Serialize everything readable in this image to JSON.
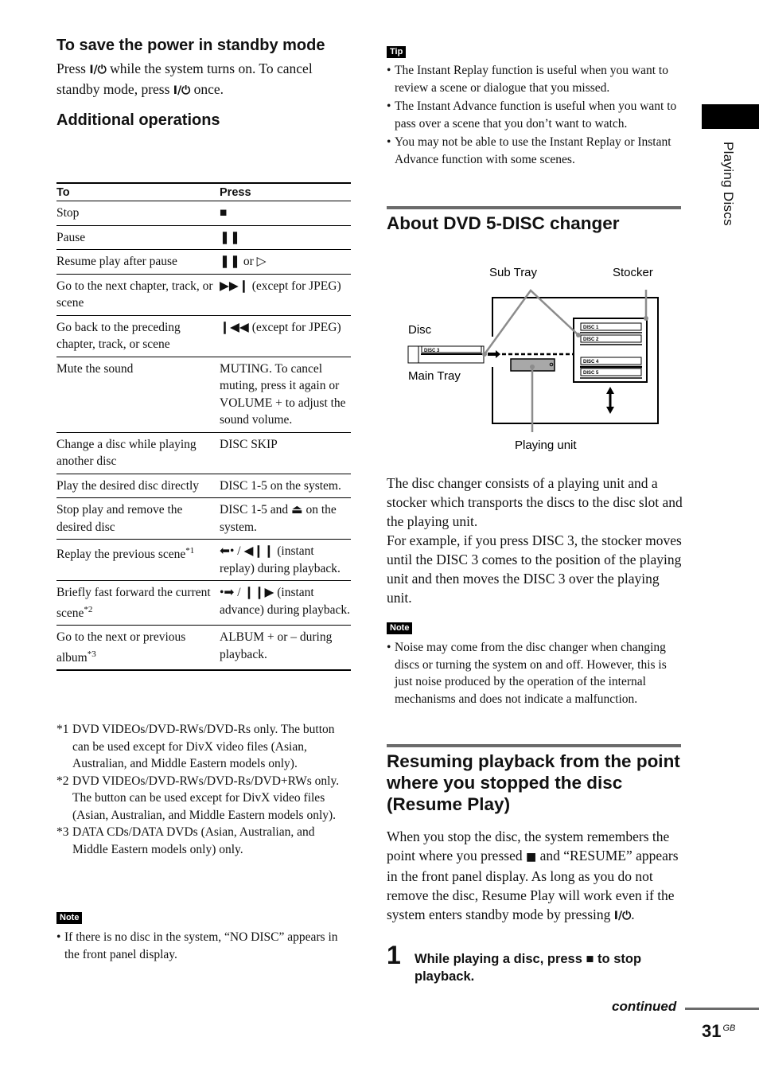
{
  "left": {
    "standby_heading": "To save the power in standby mode",
    "standby_text_1": "Press ",
    "standby_text_2": " while the system turns on. To cancel standby mode, press ",
    "standby_text_3": " once.",
    "power_symbol": "I/⏻",
    "ops_heading": "Additional operations",
    "table": {
      "headers": [
        "To",
        "Press"
      ],
      "rows": [
        {
          "to": "Stop",
          "press": "■"
        },
        {
          "to": "Pause",
          "press": "❚❚"
        },
        {
          "to": "Resume play after pause",
          "press": "❚❚ or ▷"
        },
        {
          "to": "Go to the next chapter, track, or scene",
          "press": "▶▶❙ (except for JPEG)"
        },
        {
          "to": "Go back to the preceding chapter, track, or scene",
          "press": "❙◀◀ (except for JPEG)"
        },
        {
          "to": "Mute the sound",
          "press": "MUTING. To cancel muting, press it again or VOLUME + to adjust the sound volume."
        },
        {
          "to": "Change a disc while playing another disc",
          "press": "DISC SKIP"
        },
        {
          "to": "Play the desired disc directly",
          "press": "DISC 1-5 on the system."
        },
        {
          "to": "Stop play and remove the desired disc",
          "press": "DISC 1-5 and ⏏ on the system."
        },
        {
          "to": "Replay the previous scene",
          "to_sup": "*1",
          "press": "⬅• / ◀❙❙ (instant replay) during playback."
        },
        {
          "to": "Briefly fast forward the current scene",
          "to_sup": "*2",
          "press": "•➡ / ❙❙▶ (instant advance) during playback."
        },
        {
          "to": "Go to the next or previous album",
          "to_sup": "*3",
          "press": "ALBUM + or – during playback."
        }
      ]
    },
    "footnotes": [
      {
        "key": "*1",
        "text": "DVD VIDEOs/DVD-RWs/DVD-Rs only. The button can be used except for DivX video files (Asian, Australian, and Middle Eastern models only)."
      },
      {
        "key": "*2",
        "text": "DVD VIDEOs/DVD-RWs/DVD-Rs/DVD+RWs only. The button can be used except for DivX video files (Asian, Australian, and Middle Eastern models only)."
      },
      {
        "key": "*3",
        "text": "DATA CDs/DATA DVDs (Asian, Australian, and Middle Eastern models only) only."
      }
    ],
    "note_label": "Note",
    "note_items": [
      "If there is no disc in the system, “NO DISC” appears in the front panel display."
    ]
  },
  "right": {
    "tip_label": "Tip",
    "tip_items": [
      "The Instant Replay function is useful when you want to review a scene or dialogue that you missed.",
      "The Instant Advance function is useful when you want to pass over a scene that you don’t want to watch.",
      "You may not be able to use the Instant Replay or Instant Advance function with some scenes."
    ],
    "changer_heading": "About DVD 5-DISC changer",
    "diagram": {
      "labels": {
        "sub_tray": "Sub Tray",
        "stocker": "Stocker",
        "disc": "Disc",
        "main_tray": "Main Tray",
        "playing_unit": "Playing unit"
      },
      "discs": [
        "DISC 1",
        "DISC 2",
        "DISC 3",
        "DISC 4",
        "DISC 5"
      ]
    },
    "changer_text": "The disc changer consists of a playing unit and a stocker which transports the discs to the disc slot and the playing unit.",
    "changer_example": "For example, if you press DISC 3, the stocker moves until the DISC 3 comes to the position of the playing unit and then moves the DISC 3 over the playing unit.",
    "note_label": "Note",
    "note_items": [
      "Noise may come from the disc changer when changing discs or turning the system on and off. However, this is just noise produced by the operation of the internal mechanisms and does not indicate a malfunction."
    ],
    "resume_heading": "Resuming playback from the point where you stopped the disc (Resume Play)",
    "resume_text_1": "When you stop the disc, the system remembers the point where you pressed ",
    "resume_stop_symbol": "■",
    "resume_text_2": " and “RESUME” appears in the front panel display. As long as you do not remove the disc, Resume Play will work even if the system enters standby mode by pressing ",
    "resume_text_3": ".",
    "step_number": "1",
    "step_text_1": "While playing a disc, press ",
    "step_text_2": " to stop playback."
  },
  "side_tab": "Playing Discs",
  "footer": {
    "continued": "continued",
    "page_number": "31",
    "page_suffix": "GB"
  }
}
